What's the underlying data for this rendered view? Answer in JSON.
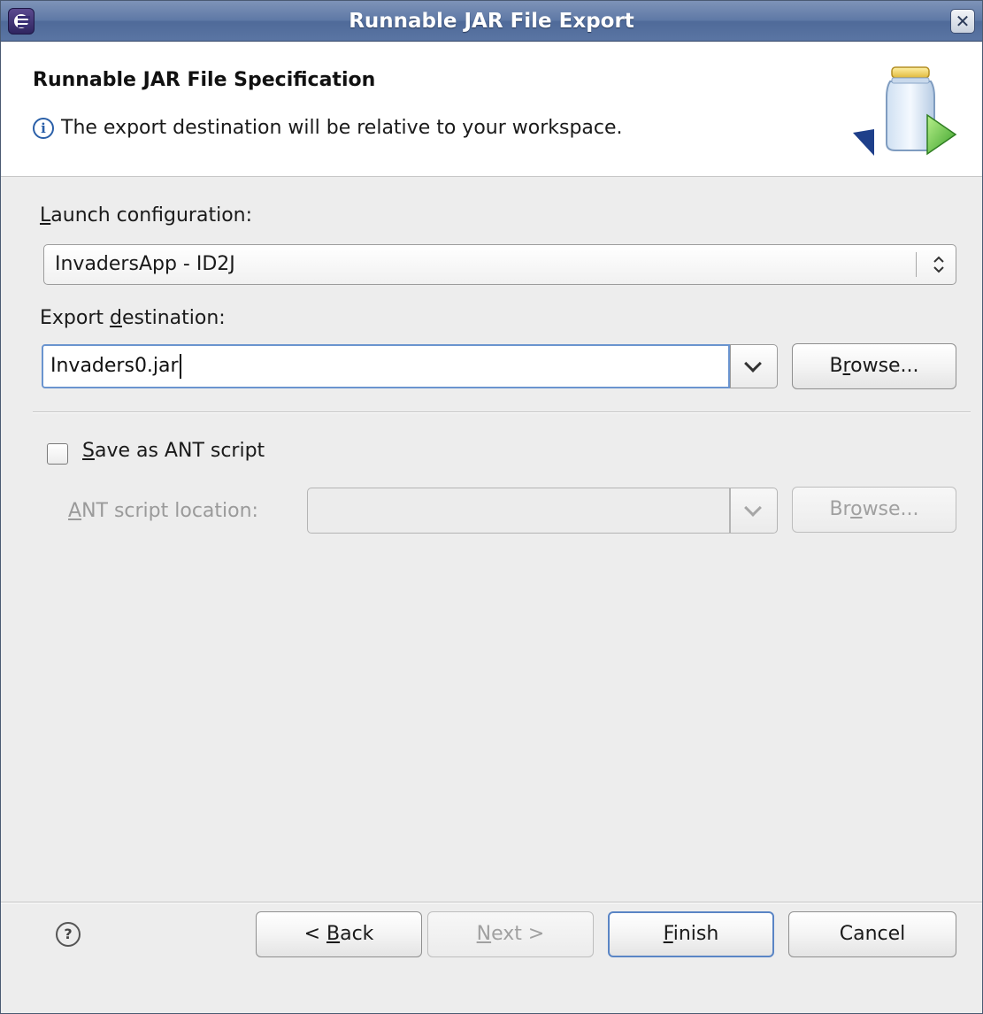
{
  "window": {
    "title": "Runnable JAR File Export",
    "close_symbol": "✕"
  },
  "banner": {
    "title": "Runnable JAR File Specification",
    "message": "The export destination will be relative to your workspace.",
    "info_icon": "i",
    "image_icon": "jar-export-icon"
  },
  "form": {
    "launch_config": {
      "label_mnemonic": "L",
      "label_rest": "aunch configuration:",
      "selected": "InvadersApp - ID2J",
      "arrows": "⌃⌄"
    },
    "export_destination": {
      "label_pre": "Export ",
      "label_mnemonic": "d",
      "label_rest": "estination:",
      "value": "Invaders0.jar",
      "browse_pre": "B",
      "browse_mnemonic": "r",
      "browse_rest": "owse..."
    },
    "save_ant": {
      "checked": false,
      "label_mnemonic": "S",
      "label_rest": "ave as ANT script"
    },
    "ant_location": {
      "label_mnemonic": "A",
      "label_rest": "NT script location:",
      "value": "",
      "browse_pre": "Br",
      "browse_mnemonic": "o",
      "browse_rest": "wse..."
    }
  },
  "footer": {
    "help_symbol": "?",
    "back": {
      "pre": "< ",
      "mnemonic": "B",
      "rest": "ack"
    },
    "next": {
      "mnemonic": "N",
      "rest": "ext >"
    },
    "finish": {
      "mnemonic": "F",
      "rest": "inish"
    },
    "cancel": "Cancel"
  },
  "colors": {
    "titlebar": "#5f79a6",
    "dialog_bg": "#ededed",
    "focus_border": "#6a94cf",
    "disabled_text": "#9a9a9a"
  }
}
